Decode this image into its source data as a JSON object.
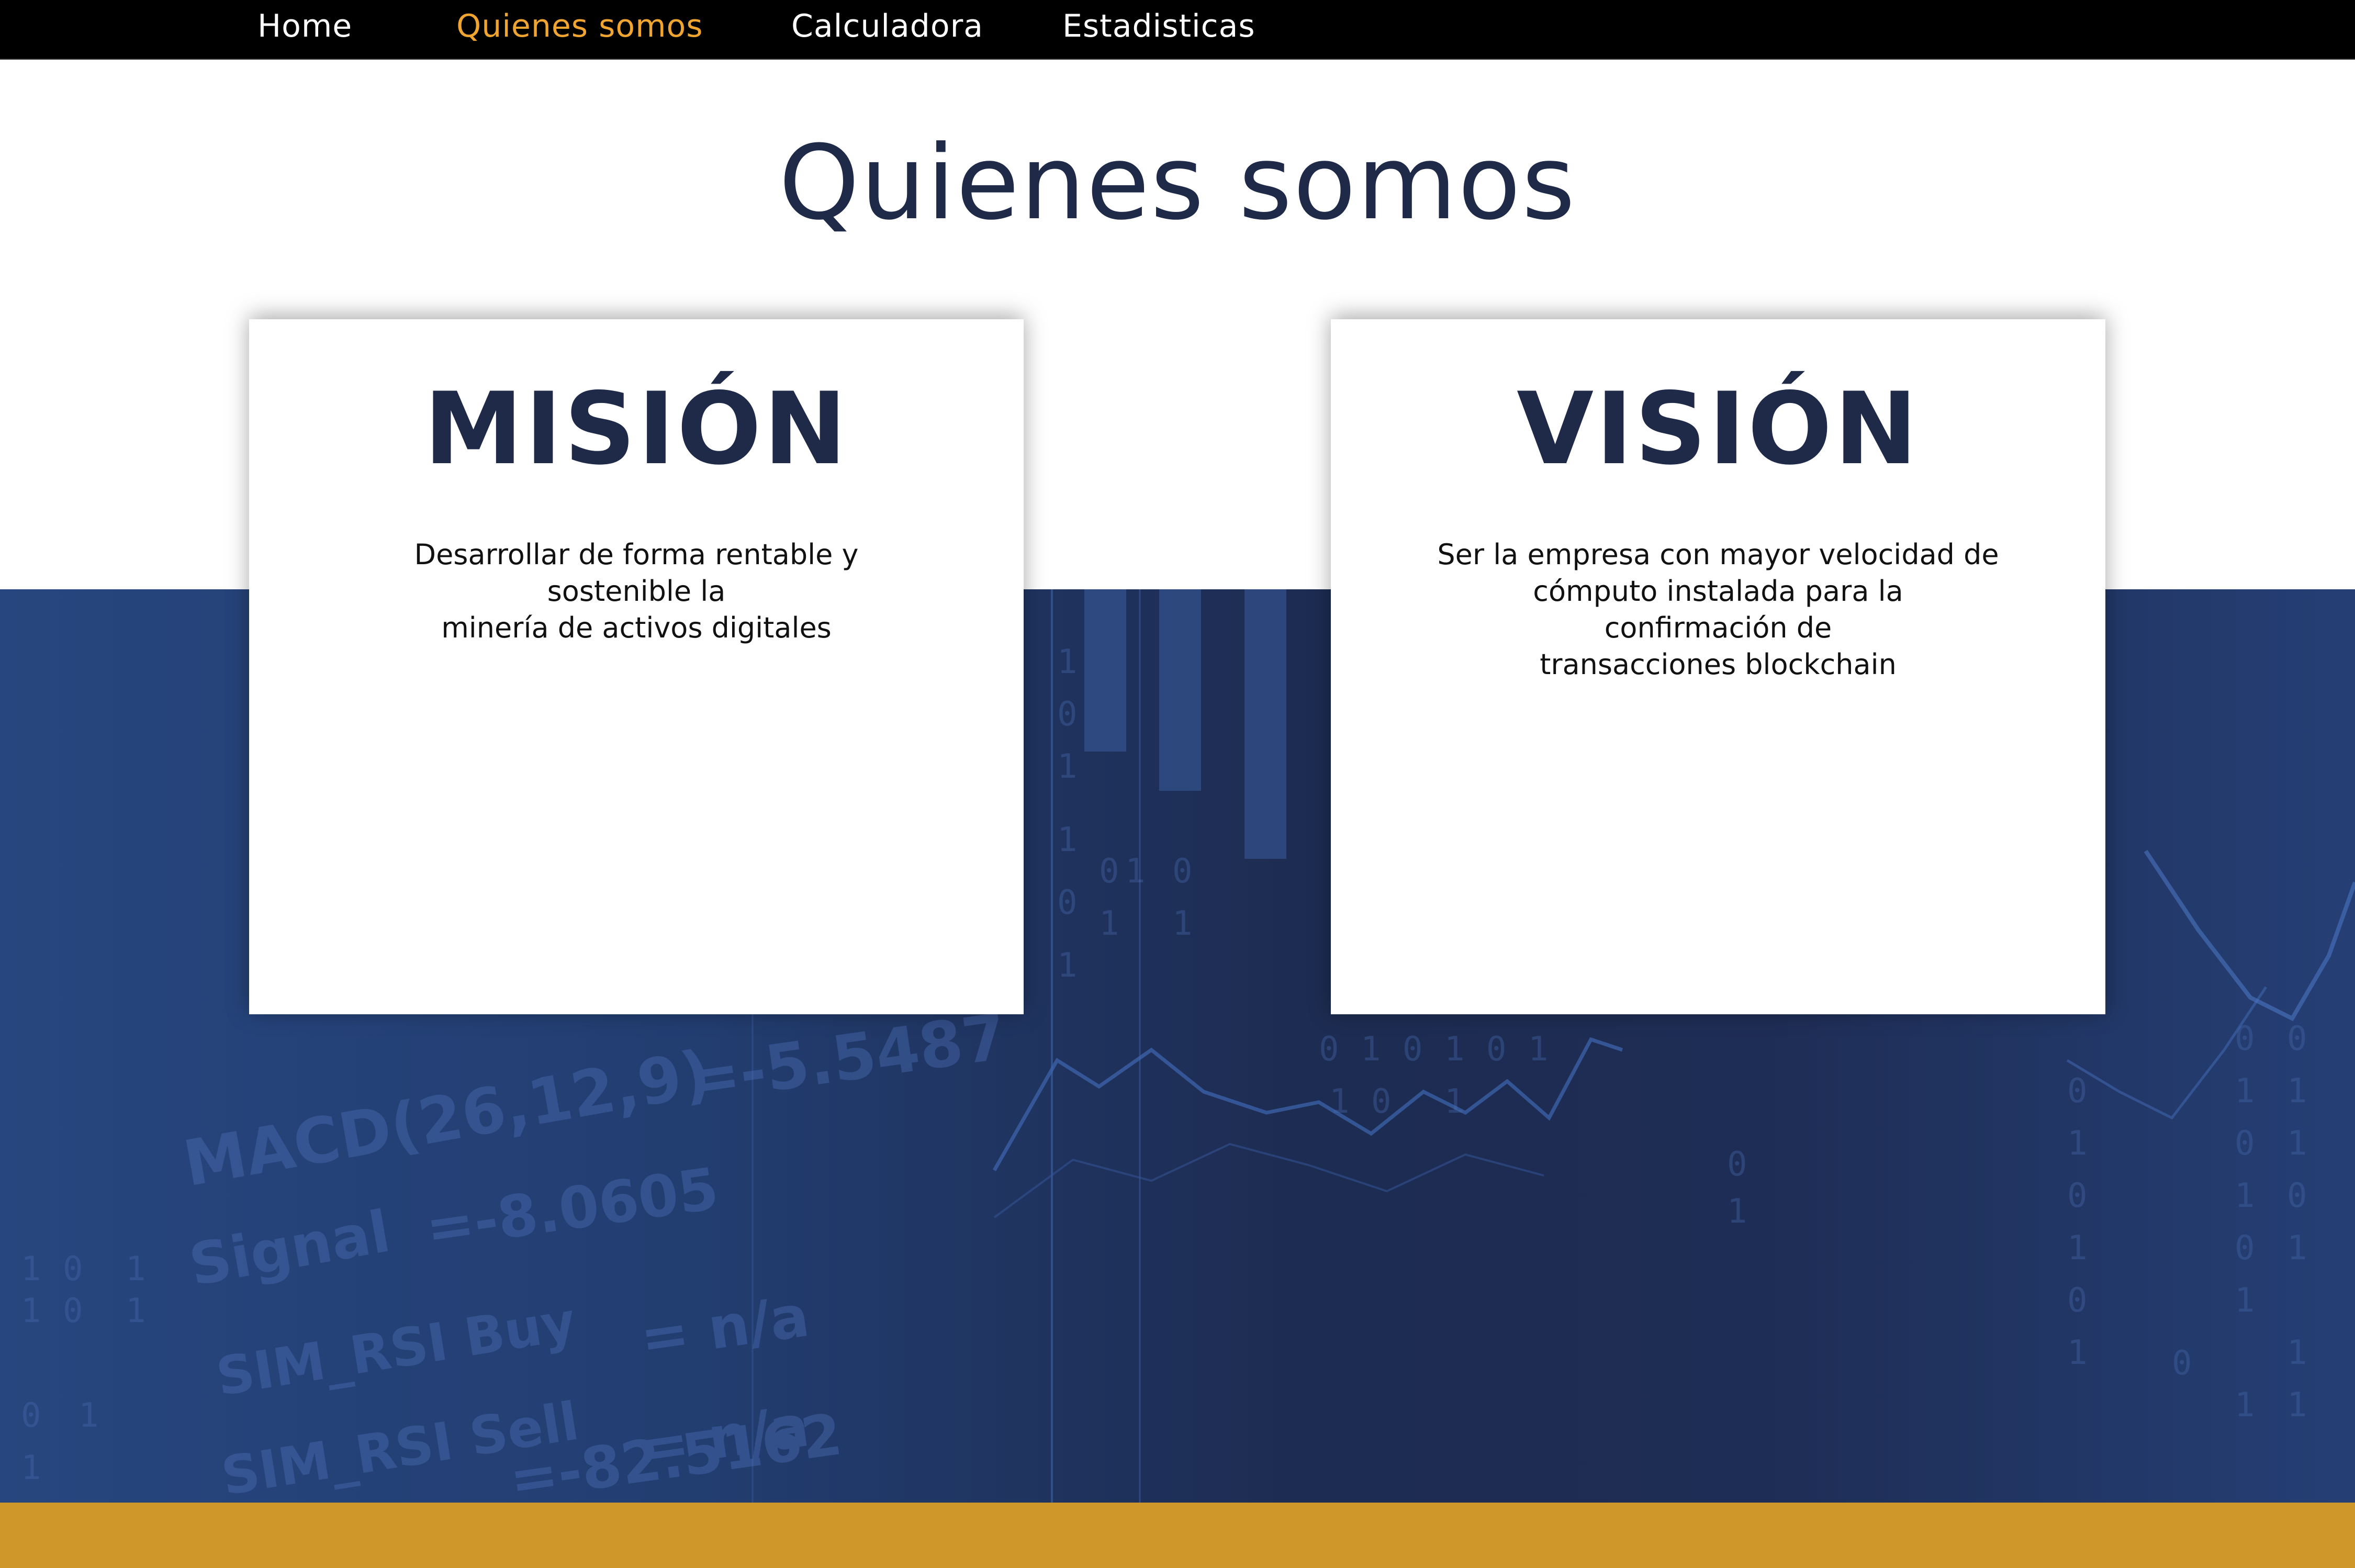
{
  "nav": {
    "items": [
      {
        "label": "Home",
        "active": false
      },
      {
        "label": "Quienes somos",
        "active": true
      },
      {
        "label": "Calculadora",
        "active": false
      },
      {
        "label": "Estadisticas",
        "active": false
      }
    ]
  },
  "page": {
    "title": "Quienes somos"
  },
  "mission": {
    "title": "MISIÓN",
    "lines": [
      "Desarrollar de forma rentable y",
      "sostenible la",
      "minería de activos digitales"
    ]
  },
  "vision": {
    "title": "VISIÓN",
    "lines": [
      "Ser la empresa con mayor velocidad de",
      "cómputo instalada para la",
      "confirmación de",
      "transacciones blockchain"
    ]
  },
  "background": {
    "watermark_texts": [
      "MACD(26,12,9)",
      "=-5.5487",
      "Signal",
      "=-8.0605",
      "SIM_RSI Buy",
      "= n/a",
      "SIM_RSI Sell",
      "= n/a",
      "=-82.5162"
    ]
  },
  "colors": {
    "nav_bg": "#000000",
    "nav_active": "#f0a530",
    "heading": "#1e2a48",
    "band": "#223d70",
    "footer": "#cf962a"
  }
}
